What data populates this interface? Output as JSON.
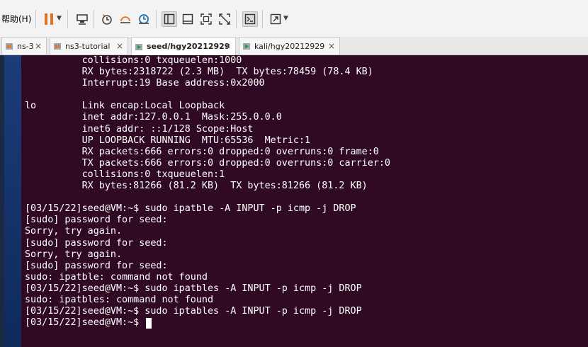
{
  "menu": {
    "help_label": "帮助(H)"
  },
  "tabs": [
    {
      "label": "ns-3",
      "active": false
    },
    {
      "label": "ns3-tutorial",
      "active": false
    },
    {
      "label": "seed/hgy20212929",
      "active": true
    },
    {
      "label": "kali/hgy20212929",
      "active": false
    }
  ],
  "tab_close_glyph": "×",
  "colors": {
    "terminal_bg": "#300a24",
    "terminal_fg": "#ffffff",
    "pause_orange": "#e8721c",
    "desktop_blue": "#15346b"
  },
  "terminal": {
    "lines": [
      "          collisions:0 txqueuelen:1000",
      "          RX bytes:2318722 (2.3 MB)  TX bytes:78459 (78.4 KB)",
      "          Interrupt:19 Base address:0x2000",
      "",
      "lo        Link encap:Local Loopback",
      "          inet addr:127.0.0.1  Mask:255.0.0.0",
      "          inet6 addr: ::1/128 Scope:Host",
      "          UP LOOPBACK RUNNING  MTU:65536  Metric:1",
      "          RX packets:666 errors:0 dropped:0 overruns:0 frame:0",
      "          TX packets:666 errors:0 dropped:0 overruns:0 carrier:0",
      "          collisions:0 txqueuelen:1",
      "          RX bytes:81266 (81.2 KB)  TX bytes:81266 (81.2 KB)",
      "",
      "[03/15/22]seed@VM:~$ sudo ipatble -A INPUT -p icmp -j DROP",
      "[sudo] password for seed:",
      "Sorry, try again.",
      "[sudo] password for seed:",
      "Sorry, try again.",
      "[sudo] password for seed:",
      "sudo: ipatble: command not found",
      "[03/15/22]seed@VM:~$ sudo ipatbles -A INPUT -p icmp -j DROP",
      "sudo: ipatbles: command not found",
      "[03/15/22]seed@VM:~$ sudo iptables -A INPUT -p icmp -j DROP"
    ],
    "prompt": "[03/15/22]seed@VM:~$ "
  }
}
